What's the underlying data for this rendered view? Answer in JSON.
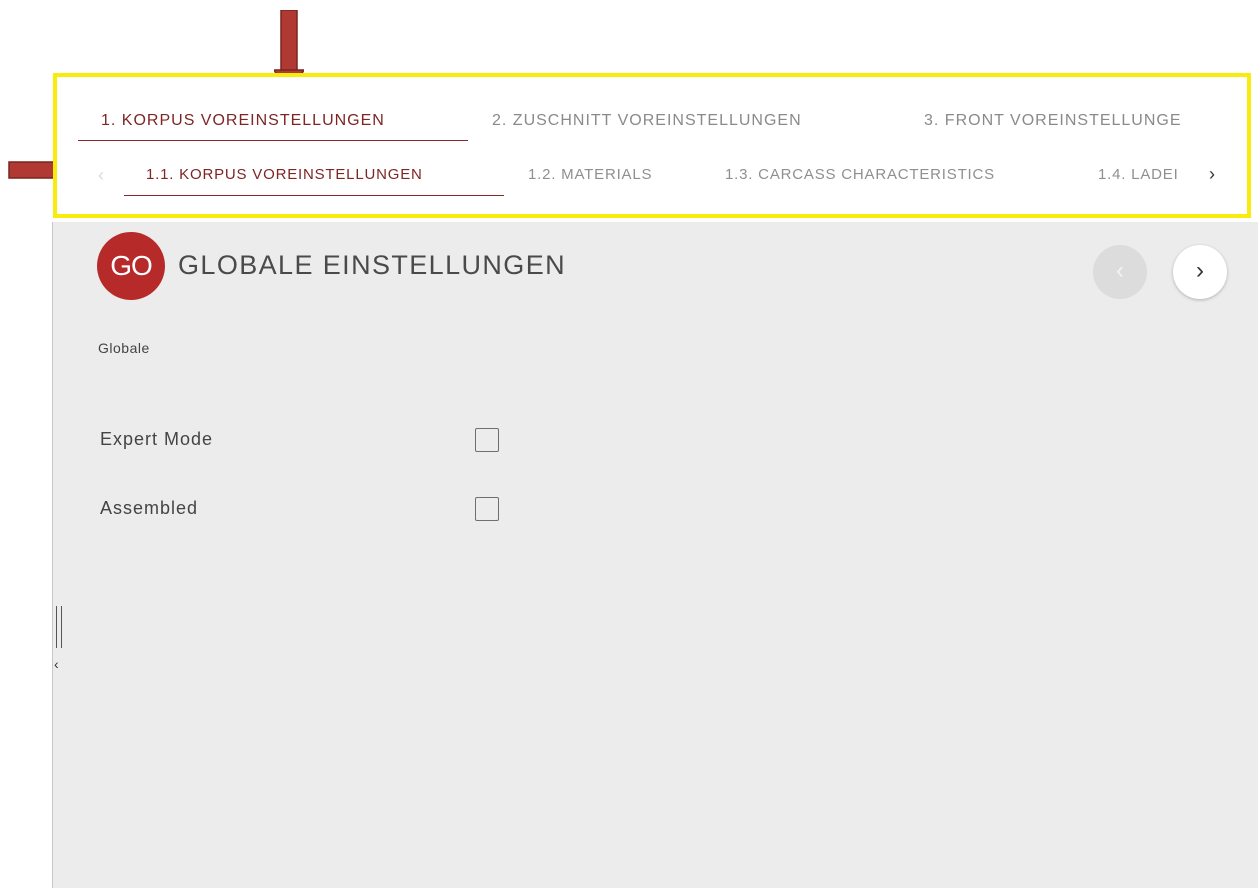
{
  "primary_tabs": [
    {
      "label": "1. KORPUS VOREINSTELLUNGEN",
      "active": true
    },
    {
      "label": "2. ZUSCHNITT VOREINSTELLUNGEN",
      "active": false
    },
    {
      "label": "3. FRONT VOREINSTELLUNGE",
      "active": false
    }
  ],
  "secondary_tabs": [
    {
      "label": "1.1. KORPUS VOREINSTELLUNGEN",
      "active": true
    },
    {
      "label": "1.2. MATERIALS",
      "active": false
    },
    {
      "label": "1.3. CARCASS CHARACTERISTICS",
      "active": false
    },
    {
      "label": "1.4. LADEI",
      "active": false
    }
  ],
  "secondary_nav": {
    "prev_glyph": "‹",
    "next_glyph": "›"
  },
  "section": {
    "badge": "GO",
    "title": "GLOBALE EINSTELLUNGEN",
    "prev_glyph": "‹",
    "next_glyph": "›"
  },
  "group_label": "Globale",
  "fields": [
    {
      "label": "Expert Mode",
      "checked": false
    },
    {
      "label": "Assembled",
      "checked": false
    }
  ],
  "colors": {
    "accent": "#b72a2a",
    "highlight": "#f7ec0b",
    "annotation_arrow": "#b03a33",
    "panel_bg": "#ececec"
  },
  "icons": {
    "collapse": "collapse-left-icon"
  }
}
